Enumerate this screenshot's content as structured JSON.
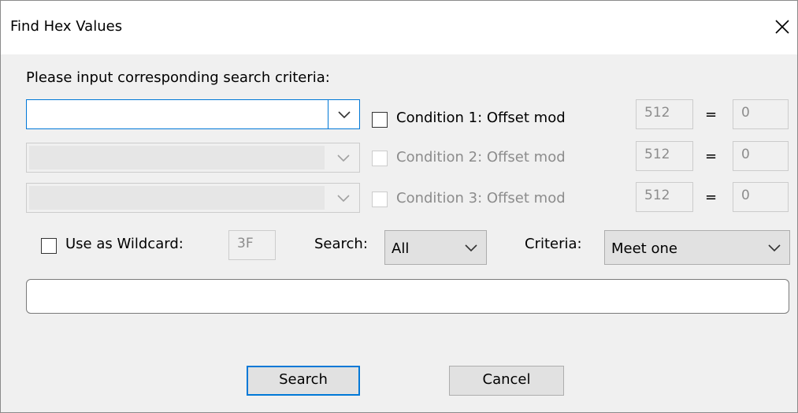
{
  "window": {
    "title": "Find Hex Values"
  },
  "prompt": "Please input corresponding search criteria:",
  "conditions": [
    {
      "label": "Condition 1: Offset mod",
      "mod": "512",
      "equals": "=",
      "result": "0"
    },
    {
      "label": "Condition 2: Offset mod",
      "mod": "512",
      "equals": "=",
      "result": "0"
    },
    {
      "label": "Condition 3: Offset mod",
      "mod": "512",
      "equals": "=",
      "result": "0"
    }
  ],
  "wildcard": {
    "label": "Use as Wildcard:",
    "value": "3F"
  },
  "search": {
    "label": "Search:",
    "value": "All"
  },
  "criteria": {
    "label": "Criteria:",
    "value": "Meet one"
  },
  "buttons": {
    "search": "Search",
    "cancel": "Cancel"
  },
  "colors": {
    "accent": "#0078d7",
    "dialog_bg": "#f0f0f0",
    "disabled_text": "#8c8c8c"
  },
  "icons": {
    "close": "close-icon",
    "dropdown": "chevron-down-icon"
  }
}
